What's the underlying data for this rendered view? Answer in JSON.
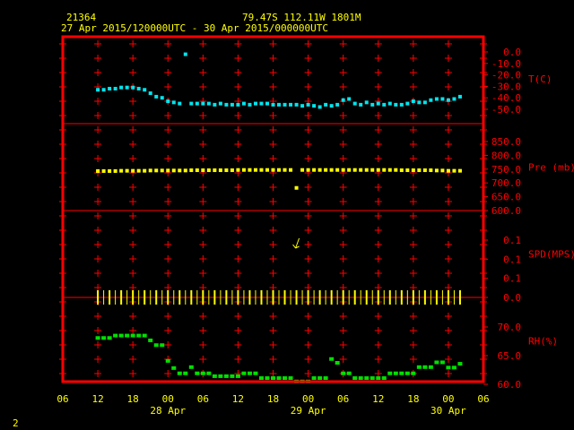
{
  "header": {
    "station_id": "21364",
    "location": "79.47S  112.11W  1801M",
    "time_range": "27 Apr 2015/120000UTC - 30 Apr 2015/000000UTC"
  },
  "footer": {
    "page_number": "2"
  },
  "colors": {
    "background": "#000000",
    "frame": "#ff0000",
    "text": "#ffff00",
    "temperature": "#00e5ee",
    "pressure": "#ffff00",
    "wind": "#ffff00",
    "humidity": "#00e000"
  },
  "chart_data": {
    "type": "scatter",
    "x_axis": {
      "ticks": [
        "06",
        "12",
        "18",
        "00",
        "06",
        "12",
        "18",
        "00",
        "06",
        "12",
        "18",
        "00",
        "06"
      ],
      "date_labels": [
        {
          "label": "28 Apr",
          "tick_index": 3
        },
        {
          "label": "29 Apr",
          "tick_index": 7
        },
        {
          "label": "30 Apr",
          "tick_index": 11
        }
      ],
      "range_hours": [
        -6,
        66
      ],
      "grid": true
    },
    "panels": [
      {
        "label": "T(C)",
        "ylim": [
          -50,
          0
        ],
        "ticks": [
          "0.0",
          "-10.0",
          "-20.0",
          "-30.0",
          "-40.0",
          "-50.0"
        ],
        "hours": [
          0,
          1,
          2,
          3,
          4,
          5,
          6,
          7,
          8,
          9,
          10,
          11,
          12,
          13,
          14,
          15,
          16,
          17,
          18,
          19,
          20,
          21,
          22,
          23,
          24,
          25,
          26,
          27,
          28,
          29,
          30,
          31,
          32,
          33,
          34,
          35,
          36,
          37,
          38,
          39,
          40,
          41,
          42,
          43,
          44,
          45,
          46,
          47,
          48,
          49,
          50,
          51,
          52,
          53,
          54,
          55,
          56,
          57,
          58,
          59,
          60,
          61,
          62
        ],
        "values": [
          -33,
          -33,
          -32,
          -32,
          -31,
          -31,
          -31,
          -32,
          -33,
          -36,
          -39,
          -40,
          -43,
          -44,
          -45,
          -2,
          -45,
          -45,
          -45,
          -45,
          -46,
          -45,
          -46,
          -46,
          -46,
          -45,
          -46,
          -45,
          -45,
          -45,
          -46,
          -46,
          -46,
          -46,
          -46,
          -47,
          -46,
          -47,
          -48,
          -46,
          -47,
          -46,
          -42,
          -41,
          -45,
          -46,
          -44,
          -46,
          -45,
          -46,
          -45,
          -46,
          -46,
          -45,
          -43,
          -44,
          -44,
          -42,
          -41,
          -41,
          -42,
          -41,
          -39
        ]
      },
      {
        "label": "Pre (mb)",
        "ylim": [
          600,
          850
        ],
        "ticks": [
          "850.0",
          "800.0",
          "750.0",
          "700.0",
          "650.0",
          "600.0"
        ],
        "hours": [
          0,
          1,
          2,
          3,
          4,
          5,
          6,
          7,
          8,
          9,
          10,
          11,
          12,
          13,
          14,
          15,
          16,
          17,
          18,
          19,
          20,
          21,
          22,
          23,
          24,
          25,
          26,
          27,
          28,
          29,
          30,
          31,
          32,
          33,
          34,
          35,
          36,
          37,
          38,
          39,
          40,
          41,
          42,
          43,
          44,
          45,
          46,
          47,
          48,
          49,
          50,
          51,
          52,
          53,
          54,
          55,
          56,
          57,
          58,
          59,
          60,
          61,
          62
        ],
        "values": [
          743,
          743,
          743,
          743,
          744,
          744,
          744,
          744,
          744,
          745,
          745,
          745,
          745,
          745,
          745,
          745,
          746,
          746,
          746,
          746,
          746,
          746,
          746,
          746,
          747,
          747,
          747,
          747,
          747,
          747,
          747,
          747,
          747,
          747,
          682,
          747,
          747,
          747,
          747,
          747,
          747,
          747,
          747,
          747,
          747,
          747,
          747,
          747,
          747,
          747,
          747,
          747,
          746,
          746,
          746,
          746,
          746,
          746,
          745,
          745,
          744,
          744,
          744
        ]
      },
      {
        "label": "SPD(MPS)",
        "ylim": [
          0,
          0.1
        ],
        "ticks": [
          "0.1",
          "0.1",
          "0.1",
          "0.0"
        ],
        "hours": [
          0,
          1,
          2,
          3,
          4,
          5,
          6,
          7,
          8,
          9,
          10,
          11,
          12,
          13,
          14,
          15,
          16,
          17,
          18,
          19,
          20,
          21,
          22,
          23,
          24,
          25,
          26,
          27,
          28,
          29,
          30,
          31,
          32,
          33,
          34,
          35,
          36,
          37,
          38,
          39,
          40,
          41,
          42,
          43,
          44,
          45,
          46,
          47,
          48,
          49,
          50,
          51,
          52,
          53,
          54,
          55,
          56,
          57,
          58,
          59,
          60,
          61,
          62
        ],
        "values": [
          0,
          0,
          0,
          0,
          0,
          0,
          0,
          0,
          0,
          0,
          0,
          0,
          0,
          0,
          0,
          0,
          0,
          0,
          0,
          0,
          0,
          0,
          0,
          0,
          0,
          0,
          0,
          0,
          0,
          0,
          0,
          0,
          0,
          0,
          0,
          0,
          0,
          0,
          0,
          0,
          0,
          0,
          0,
          0,
          0,
          0,
          0,
          0,
          0,
          0,
          0,
          0,
          0,
          0,
          0,
          0,
          0,
          0,
          0,
          0,
          0,
          0,
          0
        ],
        "wind_arrow_hour": 34
      },
      {
        "label": "RH(%)",
        "ylim": [
          60,
          72
        ],
        "ticks": [
          "70.0",
          "65.0",
          "60.0"
        ],
        "hours": [
          0,
          1,
          2,
          3,
          4,
          5,
          6,
          7,
          8,
          9,
          10,
          11,
          12,
          13,
          14,
          15,
          16,
          17,
          18,
          19,
          20,
          21,
          22,
          23,
          24,
          25,
          26,
          27,
          28,
          29,
          30,
          31,
          32,
          33,
          34,
          35,
          36,
          37,
          38,
          39,
          40,
          41,
          42,
          43,
          44,
          45,
          46,
          47,
          48,
          49,
          50,
          51,
          52,
          53,
          54,
          55,
          56,
          57,
          58,
          59,
          60,
          61,
          62
        ],
        "values": [
          69.7,
          69.7,
          69.7,
          70.2,
          70.2,
          70.2,
          70.2,
          70.2,
          70.2,
          69.2,
          68.2,
          68.2,
          64.9,
          63.4,
          62.3,
          62.3,
          63.6,
          62.3,
          62.3,
          62.3,
          61.7,
          61.7,
          61.7,
          61.7,
          61.7,
          62.3,
          62.3,
          62.3,
          61.3,
          61.3,
          61.3,
          61.3,
          61.3,
          61.3,
          60.6,
          60.6,
          60.6,
          61.3,
          61.3,
          61.3,
          65.3,
          64.5,
          62.3,
          62.3,
          61.3,
          61.3,
          61.3,
          61.3,
          61.3,
          61.3,
          62.3,
          62.3,
          62.3,
          62.3,
          62.3,
          63.6,
          63.6,
          63.6,
          64.6,
          64.6,
          63.5,
          63.5,
          64.3
        ]
      }
    ]
  }
}
